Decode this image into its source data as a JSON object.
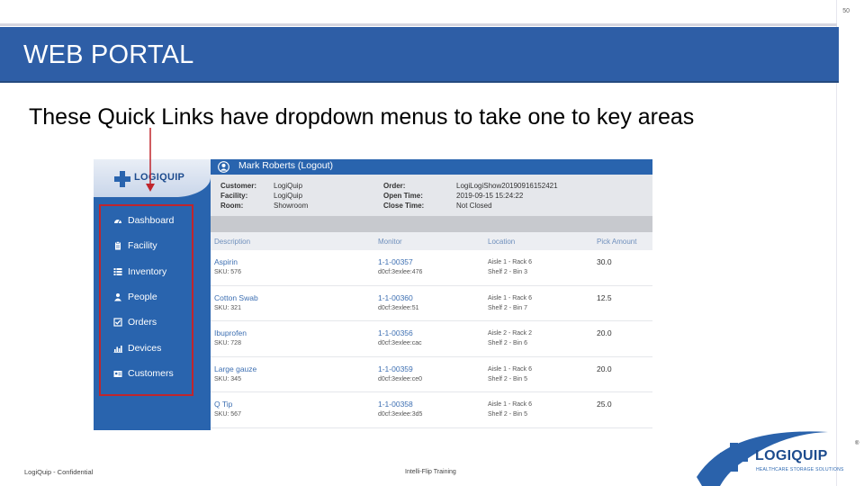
{
  "slide": {
    "page_number": "50",
    "title": "WEB PORTAL",
    "subtitle": "These Quick Links have dropdown menus to take one to key areas",
    "footer_left": "LogiQuip - Confidential",
    "footer_center": "Intelli-Flip Training"
  },
  "colors": {
    "title_bar": "#2e5ea6",
    "sidebar": "#2964ae",
    "highlight_box": "#c0252c",
    "link_text": "#3d6fb2"
  },
  "screenshot": {
    "logo_text": "LOGIQUIP",
    "user": "Mark Roberts (Logout)",
    "info": {
      "left": [
        {
          "key": "Customer:",
          "value": "LogiQuip"
        },
        {
          "key": "Facility:",
          "value": "LogiQuip"
        },
        {
          "key": "Room:",
          "value": "Showroom"
        }
      ],
      "right": [
        {
          "key": "Order:",
          "value": "LogiLogiShow20190916152421"
        },
        {
          "key": "Open Time:",
          "value": "2019-09-15 15:24:22"
        },
        {
          "key": "Close Time:",
          "value": "Not Closed"
        }
      ]
    },
    "nav": [
      {
        "label": "Dashboard",
        "icon": "dashboard-icon"
      },
      {
        "label": "Facility",
        "icon": "clipboard-icon"
      },
      {
        "label": "Inventory",
        "icon": "list-icon"
      },
      {
        "label": "People",
        "icon": "people-icon"
      },
      {
        "label": "Orders",
        "icon": "checkbox-icon"
      },
      {
        "label": "Devices",
        "icon": "bar-chart-icon"
      },
      {
        "label": "Customers",
        "icon": "customers-icon"
      }
    ],
    "table": {
      "columns": [
        "Description",
        "Monitor",
        "Location",
        "Pick Amount"
      ],
      "rows": [
        {
          "desc": "Aspirin",
          "sku": "SKU: 576",
          "monitor": "1-1-00357",
          "monitor_id": "d0cf:3exlee:476",
          "loc1": "Aisle 1 - Rack 6",
          "loc2": "Shelf 2 - Bin 3",
          "amount": "30.0"
        },
        {
          "desc": "Cotton Swab",
          "sku": "SKU: 321",
          "monitor": "1-1-00360",
          "monitor_id": "d0cf:3exlee:51",
          "loc1": "Aisle 1 - Rack 6",
          "loc2": "Shelf 2 - Bin 7",
          "amount": "12.5"
        },
        {
          "desc": "Ibuprofen",
          "sku": "SKU: 728",
          "monitor": "1-1-00356",
          "monitor_id": "d0cf:3exlee:cac",
          "loc1": "Aisle 2 - Rack 2",
          "loc2": "Shelf 2 - Bin 6",
          "amount": "20.0"
        },
        {
          "desc": "Large gauze",
          "sku": "SKU: 345",
          "monitor": "1-1-00359",
          "monitor_id": "d0cf:3exlee:ce0",
          "loc1": "Aisle 1 - Rack 6",
          "loc2": "Shelf 2 - Bin 5",
          "amount": "20.0"
        },
        {
          "desc": "Q Tip",
          "sku": "SKU: 567",
          "monitor": "1-1-00358",
          "monitor_id": "d0cf:3exlee:3d5",
          "loc1": "Aisle 1 - Rack 6",
          "loc2": "Shelf 2 - Bin 5",
          "amount": "25.0"
        }
      ]
    }
  },
  "corner_logo": {
    "name": "LOGIQUIP",
    "tagline": "HEALTHCARE STORAGE SOLUTIONS",
    "registered": "®"
  }
}
